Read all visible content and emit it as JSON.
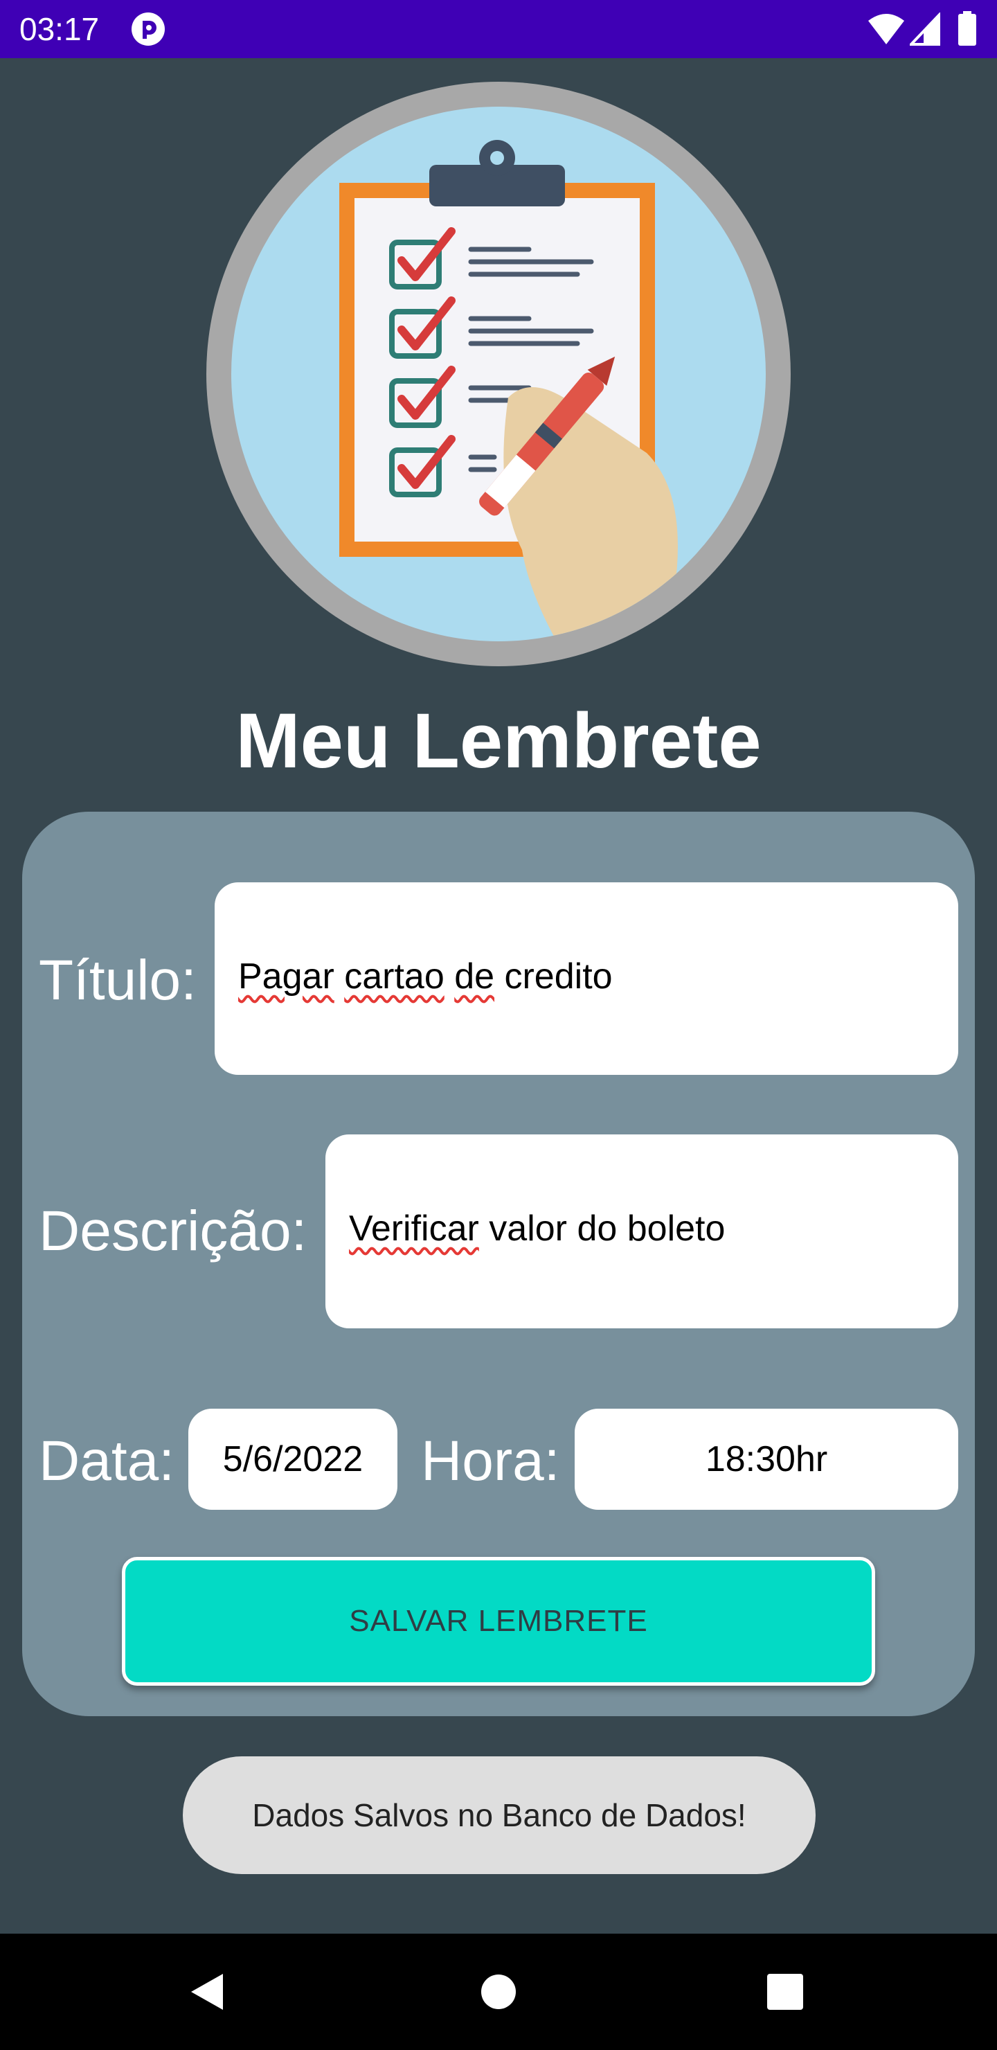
{
  "status_bar": {
    "time": "03:17",
    "app_icon": "app-notification-icon",
    "icons": [
      "wifi-icon",
      "signal-icon",
      "battery-icon"
    ],
    "background": "#3F00B5"
  },
  "header": {
    "logo_icon": "clipboard-checklist-icon",
    "title": "Meu Lembrete"
  },
  "form": {
    "title_label": "Título:",
    "title_value": {
      "words": [
        "Pagar",
        "cartao",
        "de"
      ],
      "rest": " credito"
    },
    "description_label": "Descrição:",
    "description_value": {
      "words": [
        "Verificar"
      ],
      "rest": " valor do boleto"
    },
    "date_label": "Data:",
    "date_value": "5/6/2022",
    "time_label": "Hora:",
    "time_value": "18:30hr",
    "save_label": "SALVAR LEMBRETE"
  },
  "toast": {
    "message": "Dados Salvos no Banco de Dados!"
  },
  "nav_bar": {
    "icons": [
      "back-icon",
      "home-icon",
      "recents-icon"
    ]
  },
  "colors": {
    "background": "#37474F",
    "card": "#78909C",
    "accent": "#03DAC5"
  }
}
